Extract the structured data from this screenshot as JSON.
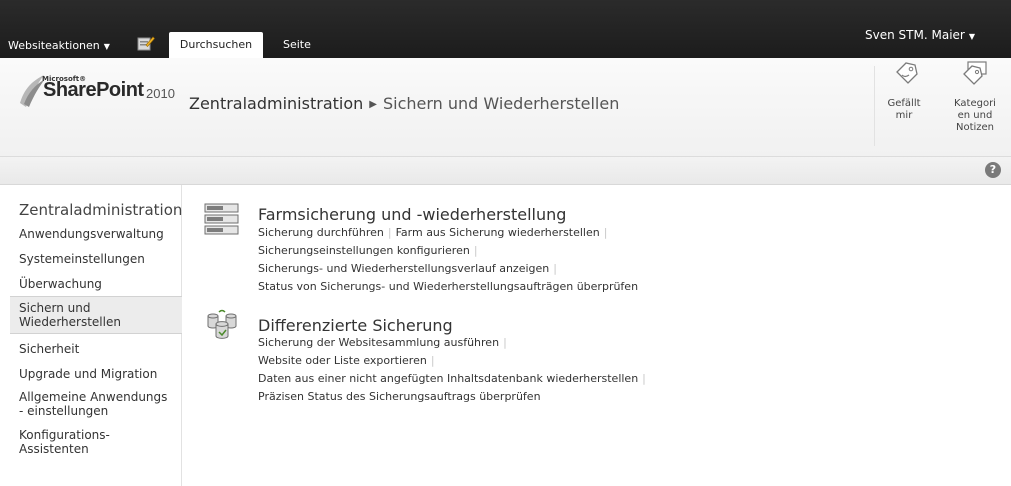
{
  "ribbon": {
    "site_actions": "Websiteaktionen",
    "site_actions_caret": "▼",
    "tabs": [
      {
        "label": "Durchsuchen",
        "active": true
      },
      {
        "label": "Seite",
        "active": false
      }
    ],
    "user": "Sven STM. Maier",
    "user_caret": "▼"
  },
  "header": {
    "logo_microsoft": "Microsoft®",
    "logo_product": "SharePoint",
    "logo_version": "2010",
    "breadcrumb": [
      "Zentraladministration",
      "Sichern und Wiederherstellen"
    ],
    "breadcrumb_separator": "▶",
    "social": {
      "like_label": "Gefällt mir",
      "tags_label": "Kategorien und Notizen",
      "tags_lines": [
        "Kategori",
        "en und",
        "Notizen"
      ]
    }
  },
  "help_icon": "?",
  "nav": {
    "heading": "Zentraladministration",
    "items": [
      {
        "label": "Anwendungsverwaltung",
        "selected": false
      },
      {
        "label": "Systemeinstellungen",
        "selected": false
      },
      {
        "label": "Überwachung",
        "selected": false
      },
      {
        "label": "Sichern und Wiederherstellen",
        "lines": [
          "Sichern und",
          "Wiederherstellen"
        ],
        "selected": true
      },
      {
        "label": "Sicherheit",
        "selected": false
      },
      {
        "label": "Upgrade und Migration",
        "selected": false
      },
      {
        "label": "Allgemeine Anwendungseinstellungen",
        "lines": [
          "Allgemeine Anwendungs",
          "- einstellungen"
        ],
        "selected": false
      },
      {
        "label": "Konfigurations-Assistenten",
        "lines": [
          "Konfigurations-",
          "Assistenten"
        ],
        "selected": false
      }
    ]
  },
  "sections": [
    {
      "title": "Farmsicherung und -wiederherstellung",
      "icon": "server-stack-icon",
      "links": [
        [
          "Sicherung durchführen",
          "Farm aus Sicherung wiederherstellen"
        ],
        [
          "Sicherungseinstellungen konfigurieren"
        ],
        [
          "Sicherungs- und Wiederherstellungsverlauf anzeigen"
        ],
        [
          "Status von Sicherungs- und Wiederherstellungsaufträgen überprüfen"
        ]
      ]
    },
    {
      "title": "Differenzierte Sicherung",
      "icon": "database-cluster-icon",
      "links": [
        [
          "Sicherung der Websitesammlung ausführen"
        ],
        [
          "Website oder Liste exportieren"
        ],
        [
          "Daten aus einer nicht angefügten Inhaltsdatenbank wiederherstellen"
        ],
        [
          "Präzisen Status des Sicherungsauftrags überprüfen"
        ]
      ]
    }
  ],
  "separator": "|",
  "colors": {
    "topbar": "#2b2b2b",
    "selected_nav": "#ececec",
    "pipe": "#c8c8c8"
  }
}
